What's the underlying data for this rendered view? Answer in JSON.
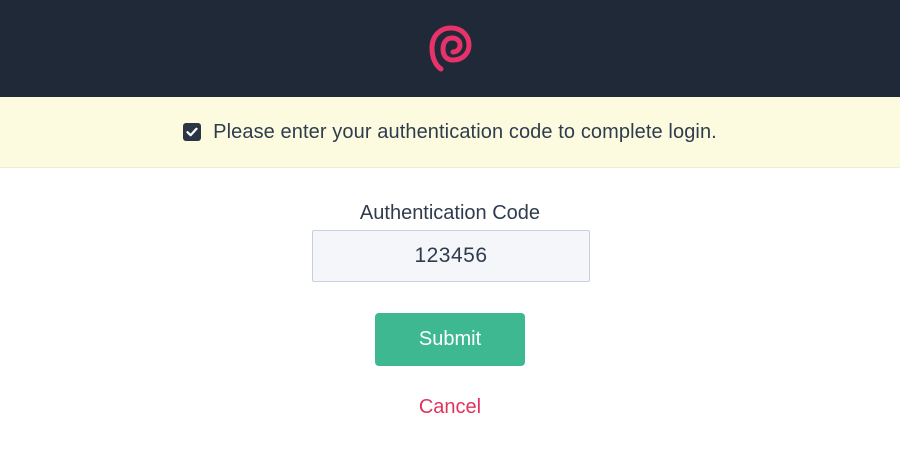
{
  "header": {
    "logo_icon": "brand-p-logo-icon",
    "brand_color": "#e8336a",
    "background": "#1f2937"
  },
  "notice": {
    "icon": "checkbox-checked-icon",
    "text": "Please enter your authentication code to complete login.",
    "background": "#fdfbdf"
  },
  "form": {
    "code_label": "Authentication Code",
    "code_value": "123456",
    "submit_label": "Submit",
    "submit_color": "#3db891",
    "cancel_label": "Cancel",
    "cancel_color": "#e0345e"
  }
}
